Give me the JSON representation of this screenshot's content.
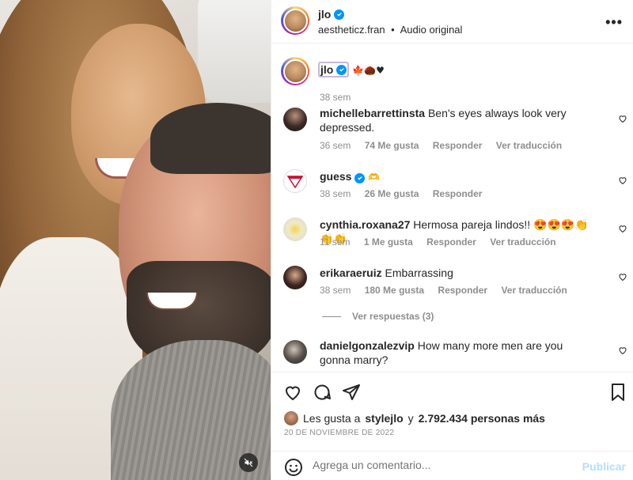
{
  "header": {
    "username": "jlo",
    "audio_source": "aestheticz.fran",
    "separator": "•",
    "audio_label": "Audio original",
    "more_label": "•••"
  },
  "caption": {
    "username": "jlo",
    "emojis": "🍁🌰♥",
    "time": "38 sem"
  },
  "comments": [
    {
      "username": "michellebarrettinsta",
      "text": "Ben's eyes always look very depressed.",
      "time": "36 sem",
      "likes": "74 Me gusta",
      "reply": "Responder",
      "translate": "Ver traducción",
      "avatar": "#2a2a2a"
    },
    {
      "username": "guess",
      "text": "🫶",
      "time": "38 sem",
      "likes": "26 Me gusta",
      "reply": "Responder",
      "translate": "",
      "verified": true,
      "avatar": "#ffffff"
    },
    {
      "username": "cynthia.roxana27",
      "text": "Hermosa pareja lindos!! 😍😍😍👏👏👏",
      "time": "11 sem",
      "likes": "1 Me gusta",
      "reply": "Responder",
      "translate": "Ver traducción",
      "avatar": "#e8e6d8"
    },
    {
      "username": "erikaraeruiz",
      "text": "Embarrassing",
      "time": "38 sem",
      "likes": "180 Me gusta",
      "reply": "Responder",
      "translate": "Ver traducción",
      "avatar": "#3a2a24"
    },
    {
      "username": "danielgonzalezvip",
      "text": "How many more men are you gonna marry?",
      "avatar": "#4a4a4a"
    }
  ],
  "view_replies": "Ver respuestas (3)",
  "likes": {
    "prefix": "Les gusta a",
    "user": "stylejlo",
    "connector": "y",
    "others": "2.792.434 personas más"
  },
  "date": "20 DE NOVIEMBRE DE 2022",
  "add_comment": {
    "placeholder": "Agrega un comentario...",
    "publish": "Publicar"
  },
  "colors": {
    "accent_blue": "#0095f6",
    "publish_disabled": "#b2dffc",
    "secondary_text": "#8e8e8e"
  }
}
